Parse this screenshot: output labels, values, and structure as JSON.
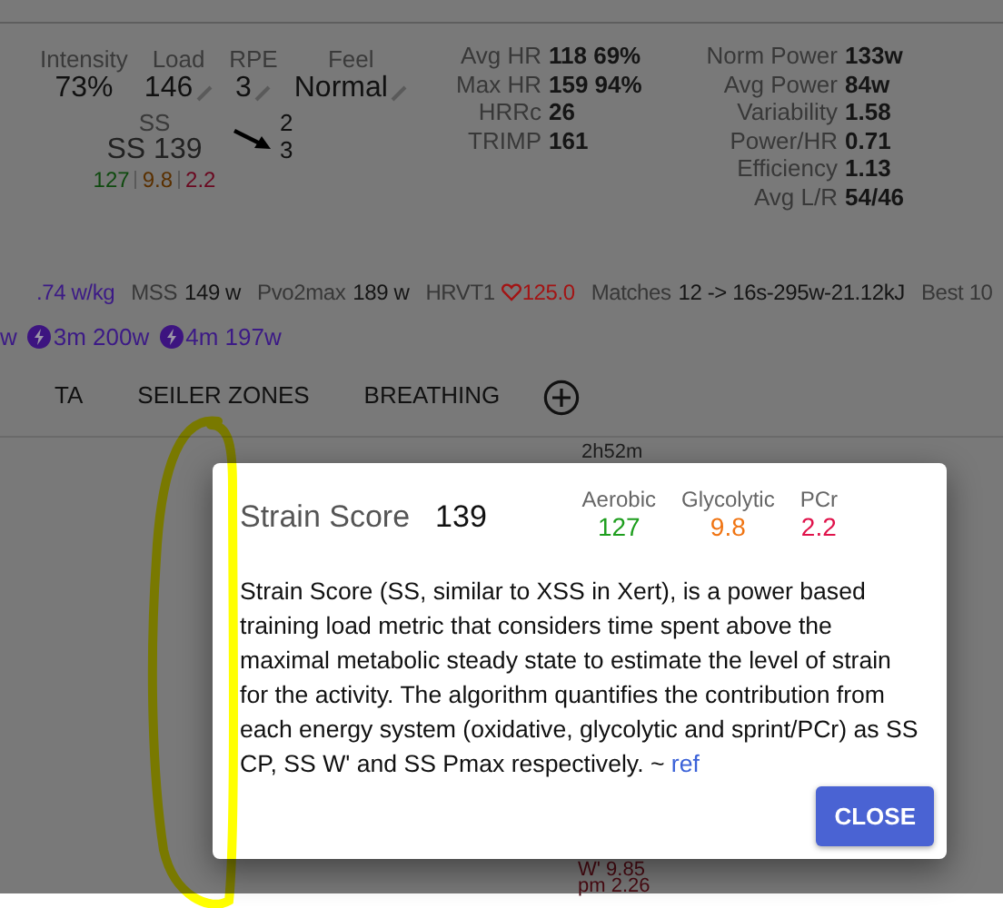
{
  "metrics": [
    {
      "label": "Intensity",
      "value": "73%",
      "editable": false
    },
    {
      "label": "Load",
      "value": "146",
      "editable": true
    },
    {
      "label": "RPE",
      "value": "3",
      "editable": true
    },
    {
      "label": "Feel",
      "value": "Normal",
      "editable": true
    }
  ],
  "strain": {
    "label": "SS",
    "value": "SS 139",
    "parts": [
      {
        "value": "127",
        "color": "#0f4a0f"
      },
      {
        "value": "9.8",
        "color": "#5a3000"
      },
      {
        "value": "2.2",
        "color": "#6a0820"
      }
    ]
  },
  "arrow_labels": [
    "2",
    "3"
  ],
  "hr_stats": [
    {
      "label": "Avg HR",
      "value": "118 69%"
    },
    {
      "label": "Max HR",
      "value": "159 94%"
    },
    {
      "label": "HRRc",
      "value": "26"
    },
    {
      "label": "TRIMP",
      "value": "161"
    }
  ],
  "power_stats": [
    {
      "label": "Norm Power",
      "value": "133w"
    },
    {
      "label": "Avg Power",
      "value": "84w"
    },
    {
      "label": "Variability",
      "value": "1.58"
    },
    {
      "label": "Power/HR",
      "value": "0.71"
    },
    {
      "label": "Efficiency",
      "value": "1.13"
    },
    {
      "label": "Avg L/R",
      "value": "54/46"
    }
  ],
  "thresholds": [
    {
      "kind": "accent",
      "value": ".74 w/kg"
    },
    {
      "kind": "plain",
      "label": "MSS",
      "value": "149 w"
    },
    {
      "kind": "plain",
      "label": "Pvo2max",
      "value": "189 w"
    },
    {
      "kind": "heart",
      "label": "HRVT1",
      "value": "125.0"
    },
    {
      "kind": "plain",
      "label": "Matches",
      "value": "12 -> 16s-295w-21.12kJ"
    },
    {
      "kind": "label_only",
      "label": "Best 10"
    }
  ],
  "efforts": [
    {
      "kind": "plain",
      "value": "w"
    },
    {
      "kind": "bolt",
      "value": "3m 200w"
    },
    {
      "kind": "bolt",
      "value": "4m 197w"
    }
  ],
  "tabs": [
    {
      "label": "TA",
      "selected": false
    },
    {
      "label": "SEILER ZONES",
      "selected": false
    },
    {
      "label": "BREATHING",
      "selected": false
    }
  ],
  "background_values": [
    {
      "value": "2h52m"
    },
    {
      "value": "W' 9.85"
    },
    {
      "value": "pm 2.26"
    }
  ],
  "dialog": {
    "title": "Strain Score",
    "value": "139",
    "systems": [
      {
        "label": "Aerobic",
        "value": "127",
        "color": "#1e9e1e"
      },
      {
        "label": "Glycolytic",
        "value": "9.8",
        "color": "#f07412"
      },
      {
        "label": "PCr",
        "value": "2.2",
        "color": "#e0124a"
      }
    ],
    "description": "Strain Score (SS, similar to XSS in Xert), is a power based training load metric that considers time spent above the maximal metabolic steady state to estimate the level of strain for the activity. The algorithm quantifies the contribution from each energy system (oxidative, glycolytic and sprint/PCr) as SS CP, SS W' and SS Pmax respectively. ~",
    "link": "ref",
    "button": "CLOSE"
  }
}
